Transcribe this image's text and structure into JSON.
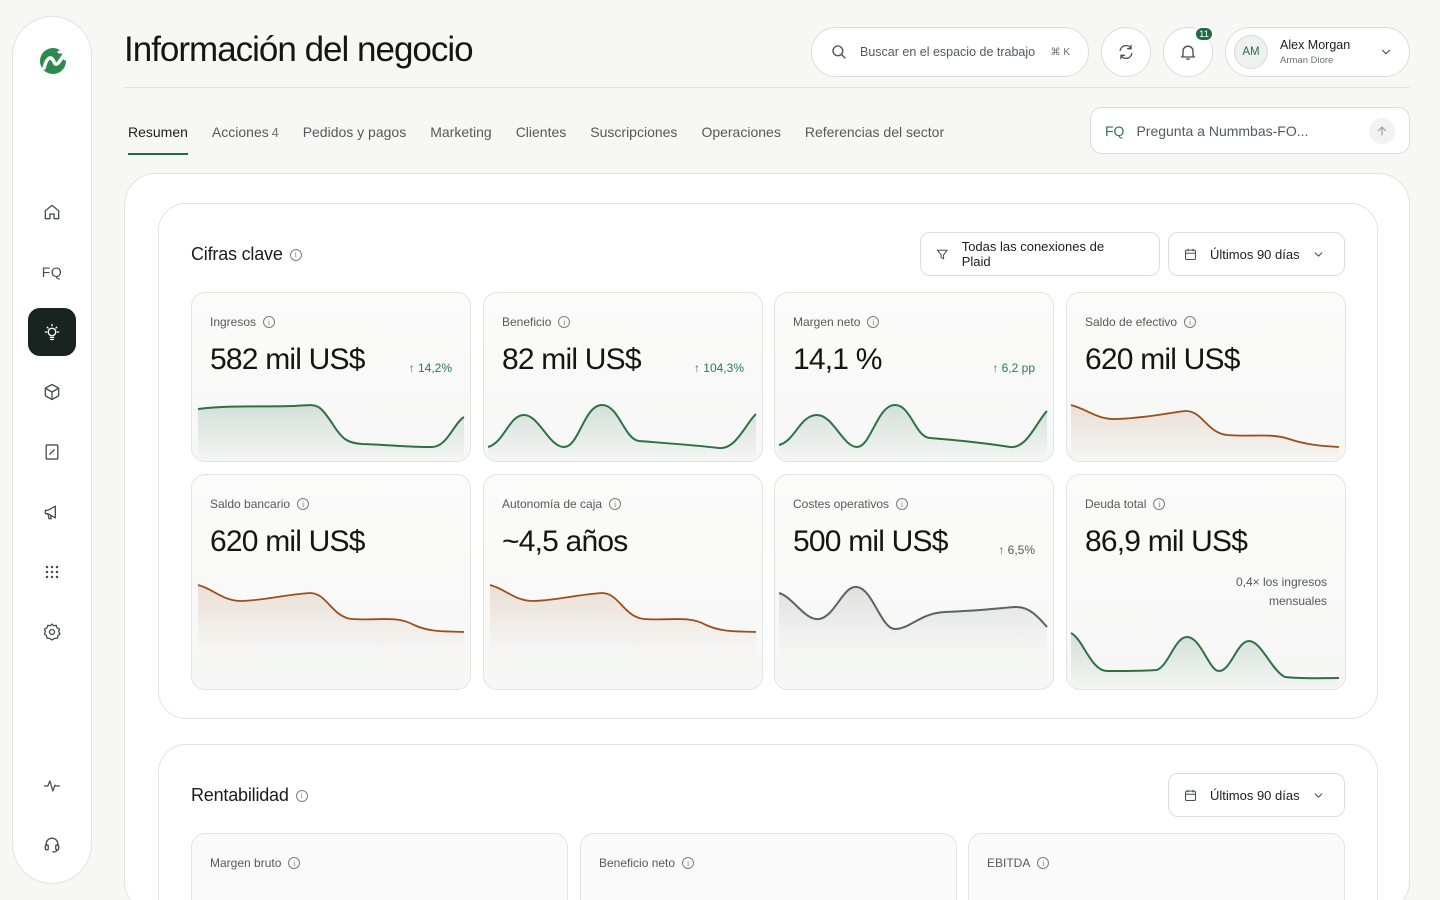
{
  "page": {
    "title": "Información del negocio"
  },
  "search": {
    "placeholder": "Buscar en el espacio de trabajo",
    "shortcut": "⌘ K"
  },
  "notifications": {
    "count": "11"
  },
  "user": {
    "initials": "AM",
    "name": "Alex Morgan",
    "org": "Arman Diore"
  },
  "sidebar": {
    "items": [
      {
        "name": "home",
        "icon": "home-icon"
      },
      {
        "name": "fq",
        "icon": "fq-icon",
        "label": "FQ"
      },
      {
        "name": "insights",
        "icon": "lightbulb-icon",
        "active": true
      },
      {
        "name": "products",
        "icon": "cube-icon"
      },
      {
        "name": "reports",
        "icon": "report-icon"
      },
      {
        "name": "marketing",
        "icon": "megaphone-icon"
      },
      {
        "name": "apps",
        "icon": "grid-icon"
      },
      {
        "name": "settings",
        "icon": "gear-icon"
      },
      {
        "name": "activity",
        "icon": "pulse-icon"
      },
      {
        "name": "support",
        "icon": "headset-icon"
      }
    ]
  },
  "tabs": [
    {
      "label": "Resumen",
      "active": true
    },
    {
      "label": "Acciones",
      "count": "4"
    },
    {
      "label": "Pedidos y pagos"
    },
    {
      "label": "Marketing"
    },
    {
      "label": "Clientes"
    },
    {
      "label": "Suscripciones"
    },
    {
      "label": "Operaciones"
    },
    {
      "label": "Referencias del sector"
    }
  ],
  "ask": {
    "placeholder": "Pregunta a Nummbas-FO...",
    "icon_text": "FQ"
  },
  "key_figures": {
    "title": "Cifras clave",
    "filter_label": "Todas las conexiones de Plaid",
    "period_label": "Últimos 90 días",
    "cards": [
      {
        "label": "Ingresos",
        "value": "582 mil US$",
        "change": "↑ 14,2%",
        "trend": "green"
      },
      {
        "label": "Beneficio",
        "value": "82 mil US$",
        "change": "↑ 104,3%",
        "trend": "green"
      },
      {
        "label": "Margen neto",
        "value": "14,1 %",
        "change": "↑ 6,2 pp",
        "trend": "green"
      },
      {
        "label": "Saldo de efectivo",
        "value": "620 mil US$",
        "change": "",
        "trend": "brown"
      },
      {
        "label": "Saldo bancario",
        "value": "620 mil US$",
        "change": "",
        "trend": "brown"
      },
      {
        "label": "Autonomía de caja",
        "value": "~4,5 años",
        "change": "",
        "trend": "brown"
      },
      {
        "label": "Costes operativos",
        "value": "500 mil US$",
        "change": "↑ 6,5%",
        "trend": "gray"
      },
      {
        "label": "Deuda total",
        "value": "86,9 mil US$",
        "note_line1": "0,4× los ingresos",
        "note_line2": "mensuales",
        "trend": "green"
      }
    ]
  },
  "profitability": {
    "title": "Rentabilidad",
    "period_label": "Últimos 90 días",
    "cards": [
      {
        "label": "Margen bruto"
      },
      {
        "label": "Beneficio neto"
      },
      {
        "label": "EBITDA"
      }
    ]
  },
  "colors": {
    "accent": "#1e6b45",
    "green_line": "#2f7045",
    "brown_line": "#9a4f1c",
    "gray_line": "#5e6361"
  }
}
